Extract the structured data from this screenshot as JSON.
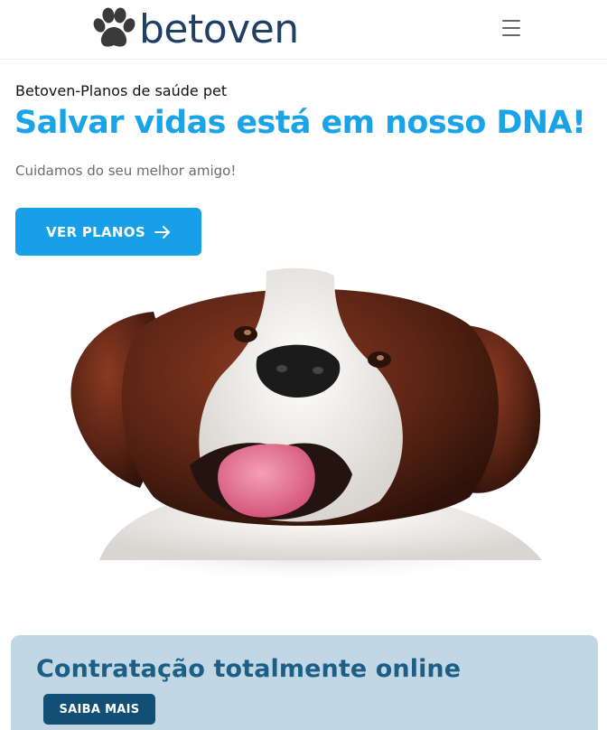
{
  "brand": {
    "name": "betoven",
    "logo_color": "#1f3f66",
    "icon": "paw-icon"
  },
  "header": {
    "menu_icon": "hamburger-menu-icon"
  },
  "hero": {
    "eyebrow": "Betoven-Planos de saúde pet",
    "title": "Salvar vidas está em nosso DNA!",
    "subtitle": "Cuidamos do seu melhor amigo!",
    "cta_label": "VER PLANOS",
    "cta_icon": "arrow-right-icon",
    "accent_color": "#1aa3e6"
  },
  "image": {
    "subject": "dog-photo"
  },
  "promo": {
    "title": "Contratação totalmente online",
    "button_label": "SAIBA MAIS",
    "background": "#c1d7e3",
    "title_color": "#1c5f86",
    "button_color": "#124f75"
  }
}
